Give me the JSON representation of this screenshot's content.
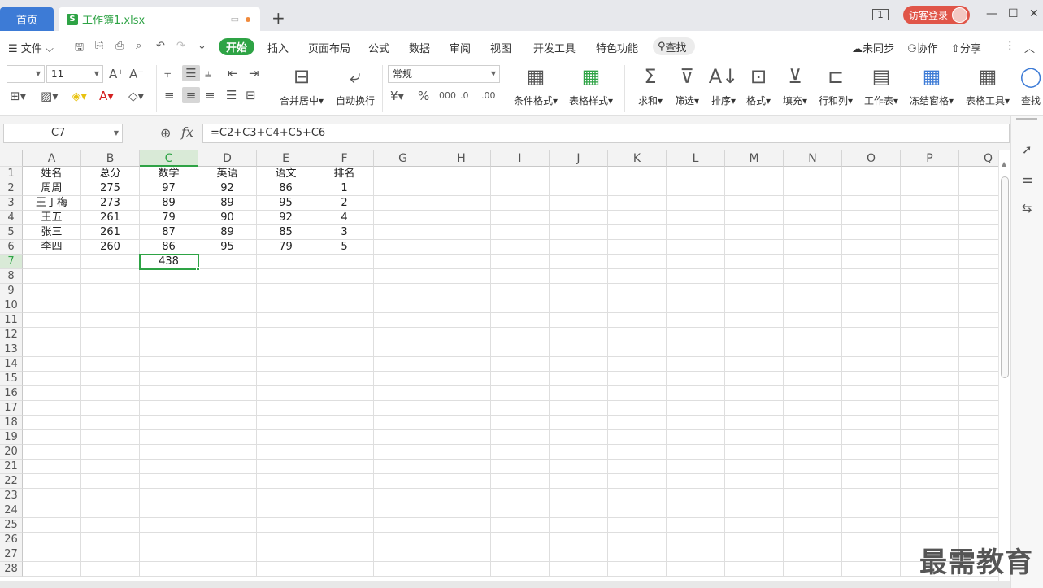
{
  "tabs": {
    "home": "首页",
    "file": "工作簿1.xlsx"
  },
  "login": "访客登录",
  "menubar": {
    "file": "文件",
    "items": [
      "开始",
      "插入",
      "页面布局",
      "公式",
      "数据",
      "审阅",
      "视图",
      "开发工具",
      "特色功能"
    ],
    "search": "查找",
    "right": [
      "未同步",
      "协作",
      "分享"
    ]
  },
  "ribbon": {
    "font_size": "11",
    "number_format": "常规",
    "merge": "合并居中",
    "wrap": "自动换行",
    "cond_format": "条件格式",
    "table_style": "表格样式",
    "sum": "求和",
    "filter": "筛选",
    "sort": "排序",
    "format": "格式",
    "fill": "填充",
    "rowcol": "行和列",
    "sheet": "工作表",
    "freeze": "冻结窗格",
    "tabletool": "表格工具",
    "find": "查找"
  },
  "formula": {
    "namebox": "C7",
    "fx": "fx",
    "value": "=C2+C3+C4+C5+C6"
  },
  "columns": [
    "A",
    "B",
    "C",
    "D",
    "E",
    "F",
    "G",
    "H",
    "I",
    "J",
    "K",
    "L",
    "M",
    "N",
    "O",
    "P",
    "Q"
  ],
  "rows": [
    "1",
    "2",
    "3",
    "4",
    "5",
    "6",
    "7",
    "8",
    "9",
    "10",
    "11",
    "12",
    "13",
    "14",
    "15",
    "16",
    "17",
    "18",
    "19",
    "20",
    "21",
    "22",
    "23",
    "24",
    "25",
    "26",
    "27",
    "28"
  ],
  "cells": [
    [
      "姓名",
      "总分",
      "数学",
      "英语",
      "语文",
      "排名"
    ],
    [
      "周周",
      "275",
      "97",
      "92",
      "86",
      "1"
    ],
    [
      "王丁梅",
      "273",
      "89",
      "89",
      "95",
      "2"
    ],
    [
      "王五",
      "261",
      "79",
      "90",
      "92",
      "4"
    ],
    [
      "张三",
      "261",
      "87",
      "89",
      "85",
      "3"
    ],
    [
      "李四",
      "260",
      "86",
      "95",
      "79",
      "5"
    ],
    [
      "",
      "",
      "438",
      "",
      "",
      ""
    ]
  ],
  "watermark": "最需教育",
  "colors": {
    "accent": "#2ea345",
    "tab_blue": "#3d7bd6",
    "login_red": "#e05548"
  }
}
